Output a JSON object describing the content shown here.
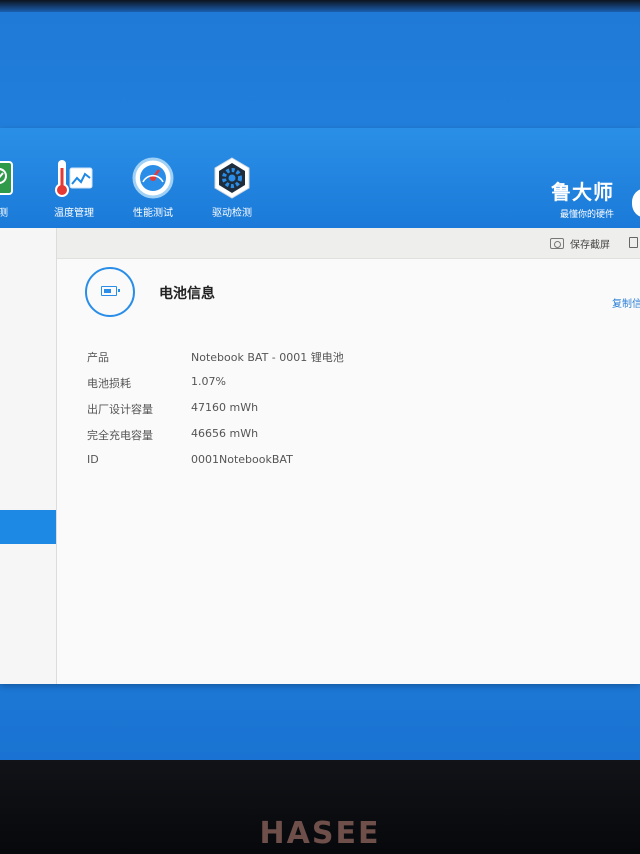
{
  "toolbar": {
    "items": [
      {
        "label": "检测",
        "icon": "hardware-detect-icon"
      },
      {
        "label": "温度管理",
        "icon": "temperature-icon"
      },
      {
        "label": "性能测试",
        "icon": "speedometer-icon"
      },
      {
        "label": "驱动检测",
        "icon": "driver-gear-icon"
      }
    ],
    "brand_name": "鲁大师",
    "brand_slogan": "最懂你的硬件"
  },
  "content": {
    "screenshot_label": "保存截屏"
  },
  "battery": {
    "title": "电池信息",
    "copy_label": "复制信息",
    "rows": [
      {
        "label": "产品",
        "value": "Notebook BAT - 0001 锂电池"
      },
      {
        "label": "电池损耗",
        "value": "1.07%"
      },
      {
        "label": "出厂设计容量",
        "value": "47160 mWh"
      },
      {
        "label": "完全充电容量",
        "value": "46656 mWh"
      },
      {
        "label": "ID",
        "value": "0001NotebookBAT"
      }
    ]
  },
  "laptop": {
    "logo_text": "HASEE"
  },
  "colors": {
    "accent": "#2a8ee8",
    "toolbar_bg": "#1b7ad9",
    "desktop_bg": "#2489e2"
  }
}
